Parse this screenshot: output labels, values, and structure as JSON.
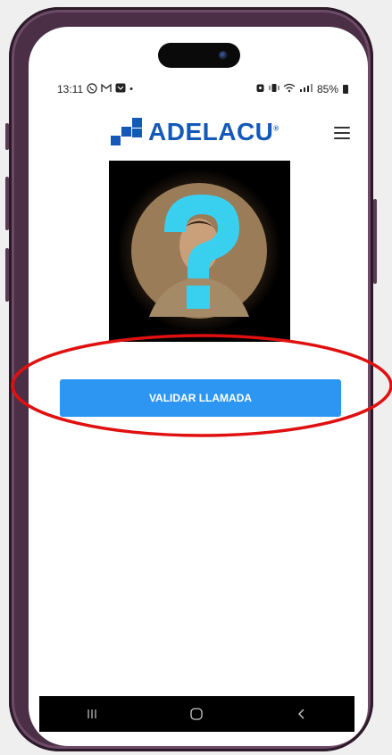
{
  "status_bar": {
    "time": "13:11",
    "left_icons": [
      "whatsapp-icon",
      "gmail-icon",
      "outlook-icon",
      "dot"
    ],
    "right_icons": [
      "alarm-icon",
      "vibrate-icon",
      "wifi-icon",
      "signal-icon",
      "battery-icon"
    ],
    "battery": "85%"
  },
  "header": {
    "logo_text": "ADELACU",
    "logo_registered": "®",
    "brand_color": "#1458b8",
    "menu_icon": "hamburger-menu-icon"
  },
  "main": {
    "avatar_icon": "question-mark-icon",
    "validate_button": "VALIDAR LLAMADA",
    "button_color": "#2d96f3"
  },
  "nav_bar": {
    "icons": [
      "recent-apps-icon",
      "home-icon",
      "back-icon"
    ]
  },
  "annotation_color": "#e01010"
}
